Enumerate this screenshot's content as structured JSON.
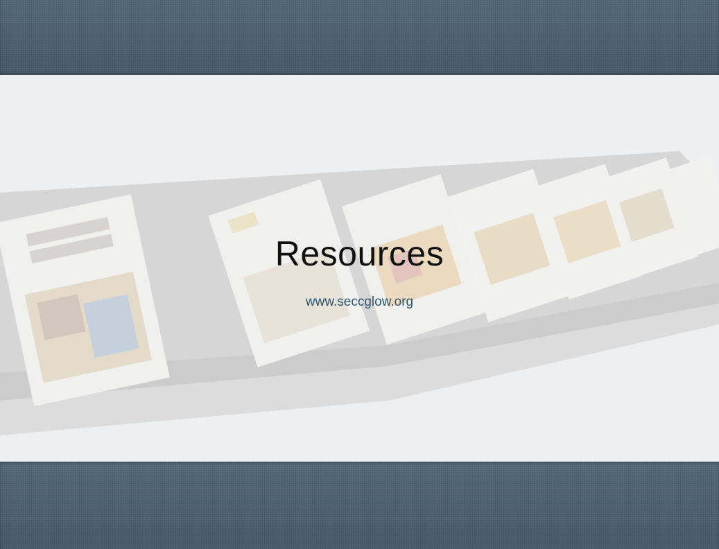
{
  "slide": {
    "title": "Resources",
    "url": "www.seccglow.org"
  },
  "colors": {
    "band": "#4c5f6f",
    "title": "#111111",
    "link": "#2c5670"
  }
}
